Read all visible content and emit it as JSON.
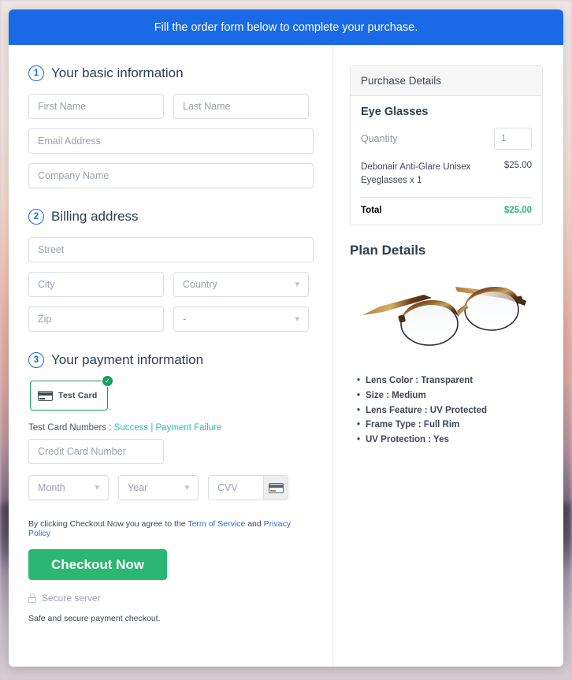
{
  "banner": {
    "text": "Fill the order form below to complete your purchase."
  },
  "steps": [
    {
      "num": "1",
      "title": "Your basic information"
    },
    {
      "num": "2",
      "title": "Billing address"
    },
    {
      "num": "3",
      "title": "Your payment information"
    }
  ],
  "basic_info": {
    "first_name_placeholder": "First Name",
    "last_name_placeholder": "Last Name",
    "email_placeholder": "Email Address",
    "company_placeholder": "Company Name"
  },
  "billing": {
    "street_placeholder": "Street",
    "city_placeholder": "City",
    "country_placeholder": "Country",
    "zip_placeholder": "Zip",
    "state_placeholder": "-"
  },
  "payment": {
    "test_card_label": "Test Card",
    "test_numbers_prefix": "Test Card Numbers : ",
    "success_link": "Success",
    "separator": " | ",
    "failure_link": "Payment Failure",
    "card_number_placeholder": "Credit Card Number",
    "month_placeholder": "Month",
    "year_placeholder": "Year",
    "cvv_placeholder": "CVV"
  },
  "agreement": {
    "prefix": "By clicking Checkout Now you agree to the ",
    "terms_link": "Term of Service",
    "middle": " and ",
    "privacy_link": "Privacy Policy"
  },
  "checkout": {
    "button_label": "Checkout Now",
    "secure_label": "Secure server",
    "safe_note": "Safe and secure payment checkout."
  },
  "purchase_details": {
    "header": "Purchase Details",
    "product_title": "Eye Glasses",
    "quantity_label": "Quantity",
    "quantity_value": "1",
    "line_item_desc": "Debonair Anti-Glare Unisex Eyeglasses x 1",
    "line_item_amount": "$25.00",
    "total_label": "Total",
    "total_amount": "$25.00"
  },
  "plan_details": {
    "title": "Plan Details",
    "specs": [
      "Lens Color    :  Transparent",
      "Size    :  Medium",
      "Lens Feature :  UV Protected",
      "Frame Type   :  Full Rim",
      "UV Protection  :  Yes"
    ]
  },
  "colors": {
    "banner_blue": "#1a6ae8",
    "accent_green": "#2bb673",
    "link_teal": "#2eb8c4",
    "link_blue": "#2d6ad4",
    "step_blue": "#1a6ae8"
  }
}
